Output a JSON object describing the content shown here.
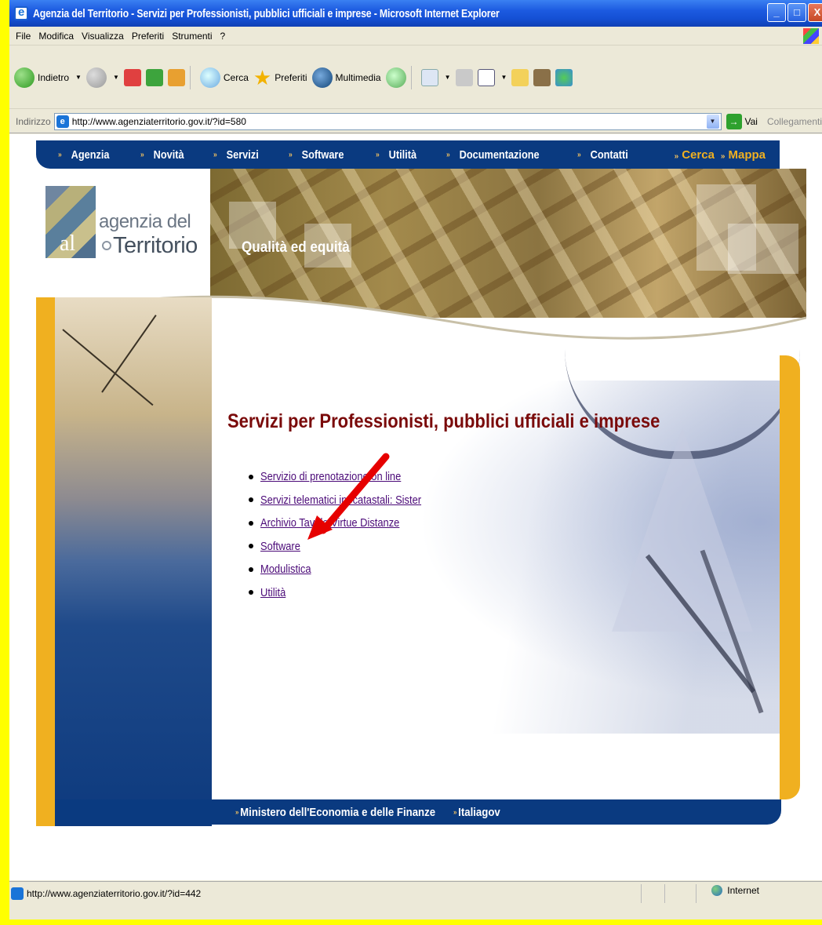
{
  "window": {
    "title": "Agenzia del Territorio - Servizi per Professionisti, pubblici ufficiali e imprese - Microsoft Internet Explorer",
    "buttons": [
      "_",
      "□",
      "X"
    ]
  },
  "menu": [
    "File",
    "Modifica",
    "Visualizza",
    "Preferiti",
    "Strumenti",
    "?"
  ],
  "toolbar": {
    "back": "Indietro",
    "search": "Cerca",
    "favorites": "Preferiti",
    "media": "Multimedia"
  },
  "address": {
    "label": "Indirizzo",
    "url": "http://www.agenziaterritorio.gov.it/?id=580",
    "go": "Vai",
    "links": "Collegamenti"
  },
  "site": {
    "nav": [
      "Agenzia",
      "Novità",
      "Servizi",
      "Software",
      "Utilità",
      "Documentazione",
      "Contatti"
    ],
    "nav_right": [
      "Cerca",
      "Mappa"
    ],
    "logo_line1": "agenzia del",
    "logo_line2": "Territorio",
    "logo_mark": "al",
    "slogan": "Qualità ed equità",
    "heading": "Servizi per Professionisti, pubblici ufficiali e imprese",
    "services": [
      "Servizio di prenotazione on line",
      "Servizi telematici ipocatastali: Sister",
      "Archivio Tavole Virtue Distanze",
      "Software",
      "Modulistica",
      "Utilità"
    ],
    "footer": [
      "Ministero dell'Economia e delle Finanze",
      "Italiagov"
    ]
  },
  "annotation": {
    "arrow_color": "#e60000"
  },
  "status": {
    "text": "http://www.agenziaterritorio.gov.it/?id=442",
    "zone": "Internet"
  },
  "colors": {
    "nav_blue": "#0a3a80",
    "accent_gold": "#f0b020",
    "heading_red": "#7a0a0a",
    "link_purple": "#4b0a78"
  }
}
